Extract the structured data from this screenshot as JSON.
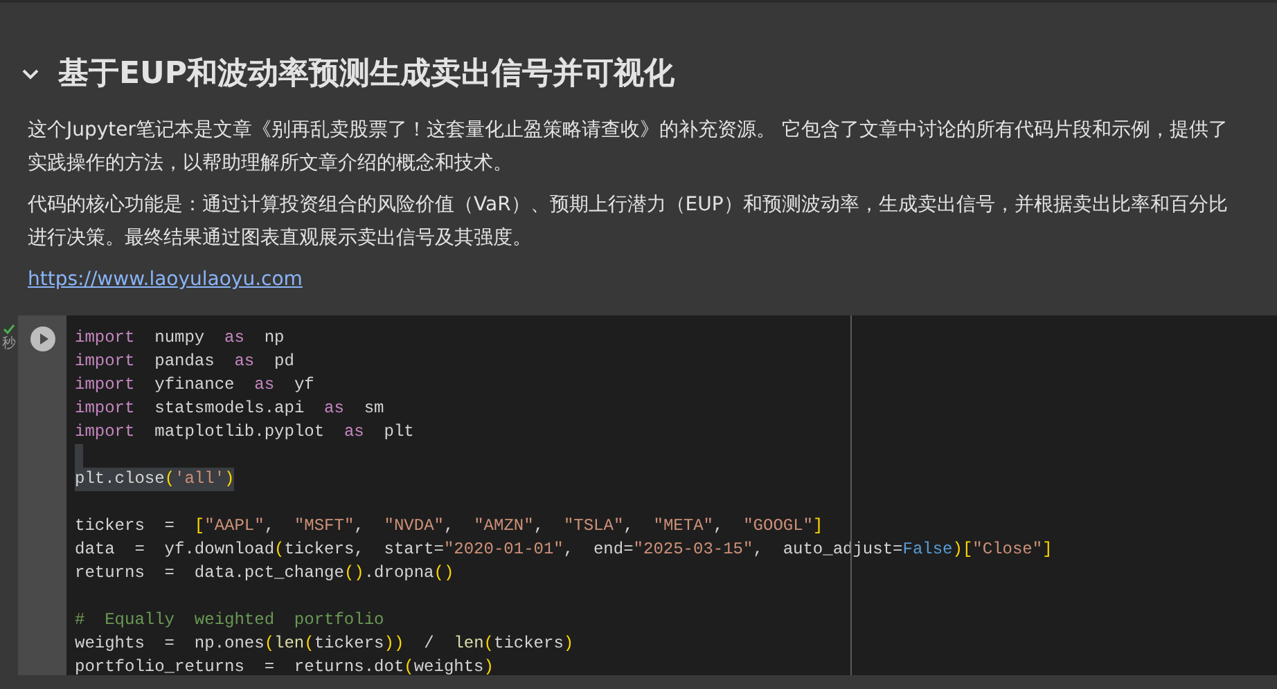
{
  "section": {
    "title": "基于EUP和波动率预测生成卖出信号并可视化",
    "expanded": true,
    "paragraphs": [
      "这个Jupyter笔记本是文章《别再乱卖股票了！这套量化止盈策略请查收》的补充资源。 它包含了文章中讨论的所有代码片段和示例，提供了实践操作的方法，以帮助理解所文章介绍的概念和技术。",
      "代码的核心功能是：通过计算投资组合的风险价值（VaR）、预期上行潜力（EUP）和预测波动率，生成卖出信号，并根据卖出比率和百分比进行决策。最终结果通过图表直观展示卖出信号及其强度。"
    ],
    "link": "https://www.laoyulaoyu.com"
  },
  "cell": {
    "executed": true,
    "time_label": "秒",
    "lines": [
      {
        "highlighted": false,
        "tokens": [
          {
            "kind": "kw",
            "text": "import"
          },
          {
            "kind": "plain",
            "text": "  numpy  "
          },
          {
            "kind": "kw",
            "text": "as"
          },
          {
            "kind": "plain",
            "text": "  np"
          }
        ]
      },
      {
        "highlighted": false,
        "tokens": [
          {
            "kind": "kw",
            "text": "import"
          },
          {
            "kind": "plain",
            "text": "  pandas  "
          },
          {
            "kind": "kw",
            "text": "as"
          },
          {
            "kind": "plain",
            "text": "  pd"
          }
        ]
      },
      {
        "highlighted": false,
        "tokens": [
          {
            "kind": "kw",
            "text": "import"
          },
          {
            "kind": "plain",
            "text": "  yfinance  "
          },
          {
            "kind": "kw",
            "text": "as"
          },
          {
            "kind": "plain",
            "text": "  yf"
          }
        ]
      },
      {
        "highlighted": false,
        "tokens": [
          {
            "kind": "kw",
            "text": "import"
          },
          {
            "kind": "plain",
            "text": "  statsmodels.api  "
          },
          {
            "kind": "kw",
            "text": "as"
          },
          {
            "kind": "plain",
            "text": "  sm"
          }
        ]
      },
      {
        "highlighted": false,
        "tokens": [
          {
            "kind": "kw",
            "text": "import"
          },
          {
            "kind": "plain",
            "text": "  matplotlib.pyplot  "
          },
          {
            "kind": "kw",
            "text": "as"
          },
          {
            "kind": "plain",
            "text": "  plt"
          }
        ]
      },
      {
        "highlighted": true
      },
      {
        "highlighted": true,
        "tokens": [
          {
            "kind": "plain",
            "text": "plt.close"
          },
          {
            "kind": "paren",
            "text": "("
          },
          {
            "kind": "str",
            "text": "'all'"
          },
          {
            "kind": "paren",
            "text": ")"
          }
        ]
      },
      {
        "highlighted": false
      },
      {
        "highlighted": false,
        "tokens": [
          {
            "kind": "plain",
            "text": "tickers  =  "
          },
          {
            "kind": "paren",
            "text": "["
          },
          {
            "kind": "str",
            "text": "\"AAPL\""
          },
          {
            "kind": "plain",
            "text": ",  "
          },
          {
            "kind": "str",
            "text": "\"MSFT\""
          },
          {
            "kind": "plain",
            "text": ",  "
          },
          {
            "kind": "str",
            "text": "\"NVDA\""
          },
          {
            "kind": "plain",
            "text": ",  "
          },
          {
            "kind": "str",
            "text": "\"AMZN\""
          },
          {
            "kind": "plain",
            "text": ",  "
          },
          {
            "kind": "str",
            "text": "\"TSLA\""
          },
          {
            "kind": "plain",
            "text": ",  "
          },
          {
            "kind": "str",
            "text": "\"META\""
          },
          {
            "kind": "plain",
            "text": ",  "
          },
          {
            "kind": "str",
            "text": "\"GOOGL\""
          },
          {
            "kind": "paren",
            "text": "]"
          }
        ]
      },
      {
        "highlighted": false,
        "tokens": [
          {
            "kind": "plain",
            "text": "data  =  yf.download"
          },
          {
            "kind": "paren",
            "text": "("
          },
          {
            "kind": "plain",
            "text": "tickers,  start="
          },
          {
            "kind": "str",
            "text": "\"2020-01-01\""
          },
          {
            "kind": "plain",
            "text": ",  end="
          },
          {
            "kind": "str",
            "text": "\"2025-03-15\""
          },
          {
            "kind": "plain",
            "text": ",  auto_adjust="
          },
          {
            "kind": "const",
            "text": "False"
          },
          {
            "kind": "paren",
            "text": ")["
          },
          {
            "kind": "str",
            "text": "\"Close\""
          },
          {
            "kind": "paren",
            "text": "]"
          }
        ]
      },
      {
        "highlighted": false,
        "tokens": [
          {
            "kind": "plain",
            "text": "returns  =  data.pct_change"
          },
          {
            "kind": "paren",
            "text": "()"
          },
          {
            "kind": "plain",
            "text": ".dropna"
          },
          {
            "kind": "paren",
            "text": "()"
          }
        ]
      },
      {
        "highlighted": false
      },
      {
        "highlighted": false,
        "tokens": [
          {
            "kind": "comment",
            "text": "#  Equally  weighted  portfolio"
          }
        ]
      },
      {
        "highlighted": false,
        "tokens": [
          {
            "kind": "plain",
            "text": "weights  =  np.ones"
          },
          {
            "kind": "paren",
            "text": "("
          },
          {
            "kind": "fn",
            "text": "len"
          },
          {
            "kind": "paren",
            "text": "("
          },
          {
            "kind": "plain",
            "text": "tickers"
          },
          {
            "kind": "paren",
            "text": "))"
          },
          {
            "kind": "plain",
            "text": "  /  "
          },
          {
            "kind": "fn",
            "text": "len"
          },
          {
            "kind": "paren",
            "text": "("
          },
          {
            "kind": "plain",
            "text": "tickers"
          },
          {
            "kind": "paren",
            "text": ")"
          }
        ]
      },
      {
        "highlighted": false,
        "tokens": [
          {
            "kind": "plain",
            "text": "portfolio_returns  =  returns.dot"
          },
          {
            "kind": "paren",
            "text": "("
          },
          {
            "kind": "plain",
            "text": "weights"
          },
          {
            "kind": "paren",
            "text": ")"
          }
        ]
      }
    ]
  }
}
